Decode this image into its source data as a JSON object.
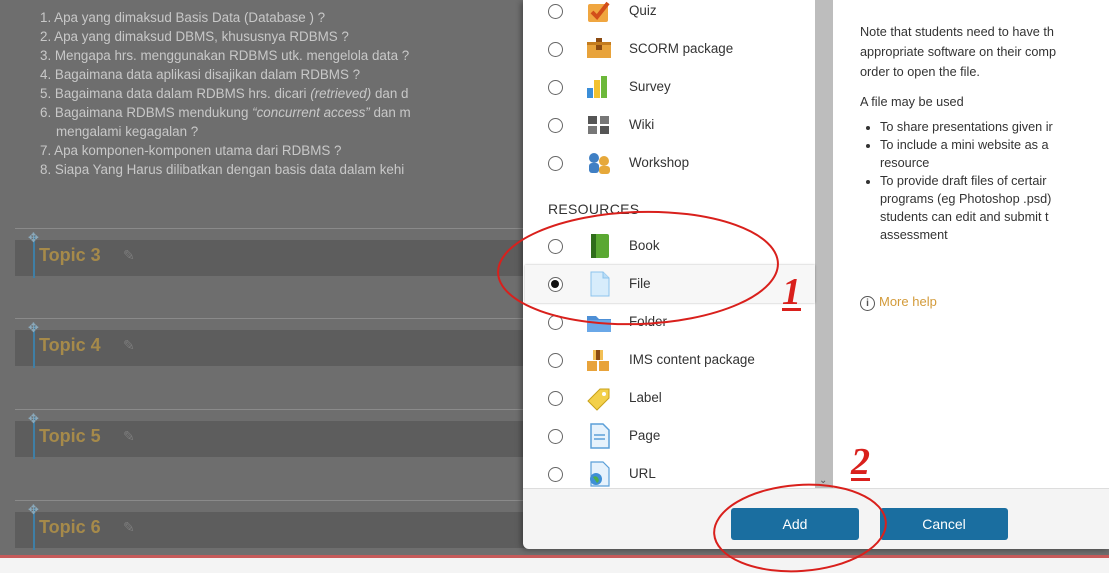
{
  "course": {
    "questions": [
      "1. Apa yang dimaksud Basis Data (Database ) ?",
      "2. Apa yang dimaksud DBMS, khususnya RDBMS ?",
      "3. Mengapa hrs. menggunakan RDBMS utk. mengelola data ?",
      "4. Bagaimana data aplikasi disajikan dalam RDBMS ?",
      "5. Bagaimana data dalam RDBMS hrs. dicari",
      "(retrieved)",
      " dan d",
      "6. Bagaimana RDBMS mendukung",
      "“concurrent access”",
      " dan m",
      "mengalami kegagalan ?",
      "7. Apa komponen-komponen utama dari RDBMS ?",
      "8. Siapa Yang Harus dilibatkan dengan basis data dalam kehi"
    ],
    "topics": [
      "Topic 3",
      "Topic 4",
      "Topic 5",
      "Topic 6"
    ]
  },
  "chooser": {
    "activities": [
      {
        "label": "Quiz",
        "icon": "quiz-icon"
      },
      {
        "label": "SCORM package",
        "icon": "scorm-package-icon"
      },
      {
        "label": "Survey",
        "icon": "survey-icon"
      },
      {
        "label": "Wiki",
        "icon": "wiki-icon"
      },
      {
        "label": "Workshop",
        "icon": "workshop-icon"
      }
    ],
    "resources_heading": "RESOURCES",
    "resources": [
      {
        "label": "Book",
        "icon": "book-icon"
      },
      {
        "label": "File",
        "icon": "file-icon"
      },
      {
        "label": "Folder",
        "icon": "folder-icon"
      },
      {
        "label": "IMS content package",
        "icon": "ims-package-icon"
      },
      {
        "label": "Label",
        "icon": "label-icon"
      },
      {
        "label": "Page",
        "icon": "page-icon"
      },
      {
        "label": "URL",
        "icon": "url-icon"
      }
    ],
    "selected": "File",
    "help": {
      "p1": [
        "Note that students need to have th",
        "appropriate software on their comp",
        "order to open the file."
      ],
      "p2": "A file may be used",
      "bullets": [
        [
          "To share presentations given ir"
        ],
        [
          "To include a mini website as a",
          "resource"
        ],
        [
          "To provide draft files of certair",
          "programs (eg Photoshop .psd)",
          "students can edit and submit t",
          "assessment"
        ]
      ],
      "more_help": "More help"
    },
    "buttons": {
      "add": "Add",
      "cancel": "Cancel"
    }
  },
  "annotations": {
    "one": "1",
    "two": "2",
    "color": "#d9201c"
  },
  "colors": {
    "primary_button": "#1a6ea0",
    "topic_title": "#a68a4a",
    "link": "#d39b3a"
  }
}
